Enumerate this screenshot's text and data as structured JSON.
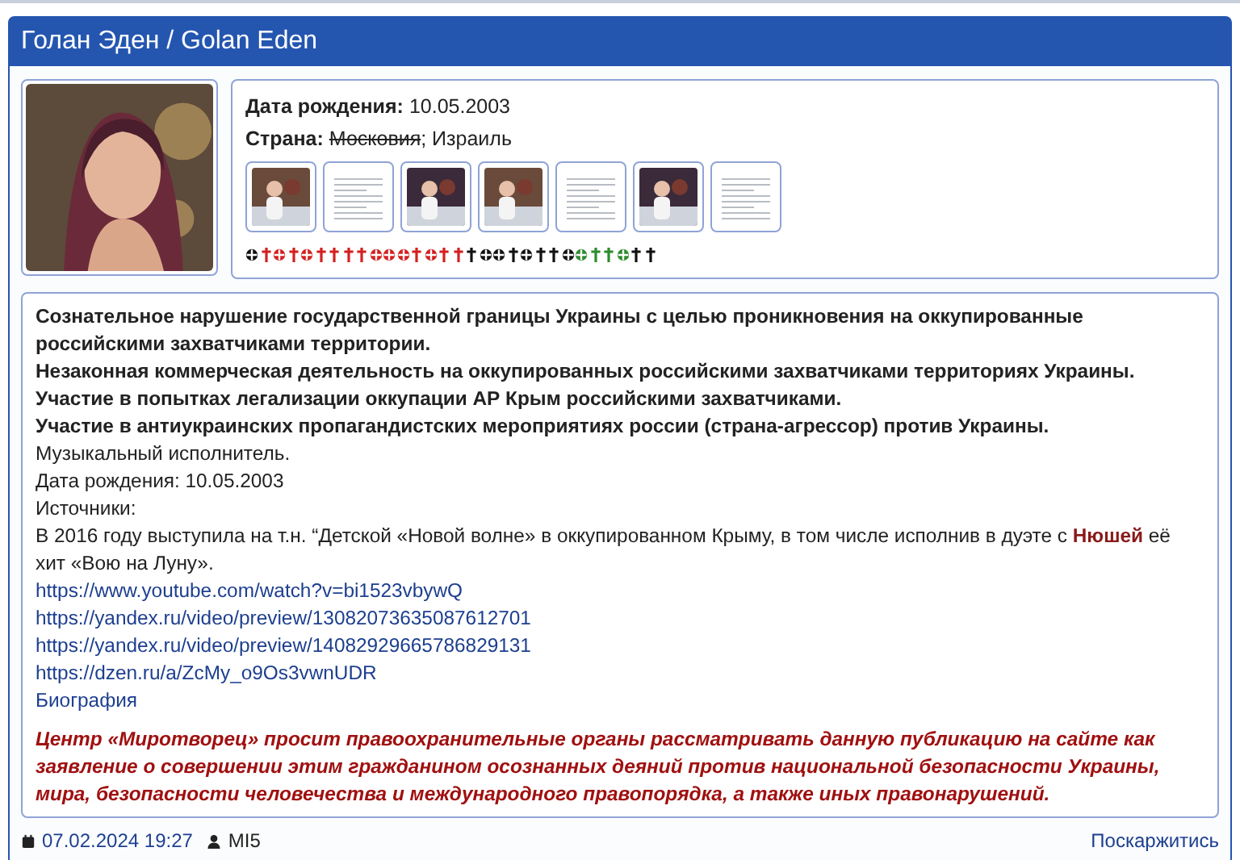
{
  "header": {
    "title": "Голан Эден / Golan Eden"
  },
  "photo": {
    "kind": "picture"
  },
  "info": [
    {
      "label": "Дата рождения:",
      "value": "10.05.2003"
    },
    {
      "label": "Страна:",
      "struck": "Московия",
      "value": "; Израиль"
    }
  ],
  "thumbnails": [
    {
      "kind": "picture"
    },
    {
      "kind": "document"
    },
    {
      "kind": "picture"
    },
    {
      "kind": "picture"
    },
    {
      "kind": "document"
    },
    {
      "kind": "picture"
    },
    {
      "kind": "document"
    }
  ],
  "marks": [
    {
      "kind": "circle",
      "color": "#111111"
    },
    {
      "kind": "cross",
      "color": "#d42020"
    },
    {
      "kind": "circle",
      "color": "#d42020"
    },
    {
      "kind": "cross",
      "color": "#d42020"
    },
    {
      "kind": "circle",
      "color": "#d42020"
    },
    {
      "kind": "cross",
      "color": "#d42020"
    },
    {
      "kind": "cross",
      "color": "#d42020"
    },
    {
      "kind": "cross",
      "color": "#d42020"
    },
    {
      "kind": "cross",
      "color": "#d42020"
    },
    {
      "kind": "circle",
      "color": "#d42020"
    },
    {
      "kind": "circle",
      "color": "#d42020"
    },
    {
      "kind": "circle",
      "color": "#d42020"
    },
    {
      "kind": "cross",
      "color": "#d42020"
    },
    {
      "kind": "circle",
      "color": "#d42020"
    },
    {
      "kind": "cross",
      "color": "#d42020"
    },
    {
      "kind": "cross",
      "color": "#d42020"
    },
    {
      "kind": "cross",
      "color": "#111111"
    },
    {
      "kind": "circle",
      "color": "#111111"
    },
    {
      "kind": "circle",
      "color": "#111111"
    },
    {
      "kind": "cross",
      "color": "#111111"
    },
    {
      "kind": "circle",
      "color": "#111111"
    },
    {
      "kind": "cross",
      "color": "#111111"
    },
    {
      "kind": "cross",
      "color": "#111111"
    },
    {
      "kind": "circle",
      "color": "#111111"
    },
    {
      "kind": "circle",
      "color": "#2e8b2e"
    },
    {
      "kind": "cross",
      "color": "#2e8b2e"
    },
    {
      "kind": "cross",
      "color": "#2e8b2e"
    },
    {
      "kind": "circle",
      "color": "#2e8b2e"
    },
    {
      "kind": "cross",
      "color": "#111111"
    },
    {
      "kind": "cross",
      "color": "#111111"
    }
  ],
  "body": [
    {
      "kind": "bold",
      "text": "Сознательное нарушение государственной границы Украины с целью проникновения на оккупированные российскими захватчиками территории."
    },
    {
      "kind": "bold",
      "text": "Незаконная коммерческая деятельность на оккупированных российскими захватчиками территориях Украины."
    },
    {
      "kind": "bold",
      "text": "Участие в попытках легализации оккупации АР Крым российскими захватчиками."
    },
    {
      "kind": "bold",
      "text": "Участие в антиукраинских пропагандистских мероприятиях россии (страна-агрессор) против Украины."
    },
    {
      "kind": "plain",
      "text": "Музыкальный исполнитель."
    },
    {
      "kind": "plain",
      "text": "Дата рождения: 10.05.2003"
    },
    {
      "kind": "plain",
      "text": "Источники:"
    },
    {
      "kind": "plain",
      "text": "В 2016 году выступила на т.н. “Детской «Новой волне» в оккупированном Крыму, в том числе исполнив в дуэте с **Нюшей** её хит «Вою на Луну»."
    },
    {
      "kind": "link",
      "text": "https://www.youtube.com/watch?v=bi1523vbywQ"
    },
    {
      "kind": "link",
      "text": "https://yandex.ru/video/preview/13082073635087612701"
    },
    {
      "kind": "link",
      "text": "https://yandex.ru/video/preview/14082929665786829131"
    },
    {
      "kind": "link",
      "text": "https://dzen.ru/a/ZcMy_o9Os3vwnUDR"
    },
    {
      "kind": "link",
      "text": "Биография"
    },
    {
      "kind": "notice",
      "text": "Центр «Миротворец» просит правоохранительные органы рассматривать данную публикацию на сайте как заявление о совершении этим гражданином осознанных деяний против национальной безопасности Украины, мира, безопасности человечества и международного правопорядка, а также иных правонарушений."
    }
  ],
  "footer": {
    "date": "07.02.2024 19:27",
    "author": "MI5",
    "report": "Поскаржитись"
  }
}
